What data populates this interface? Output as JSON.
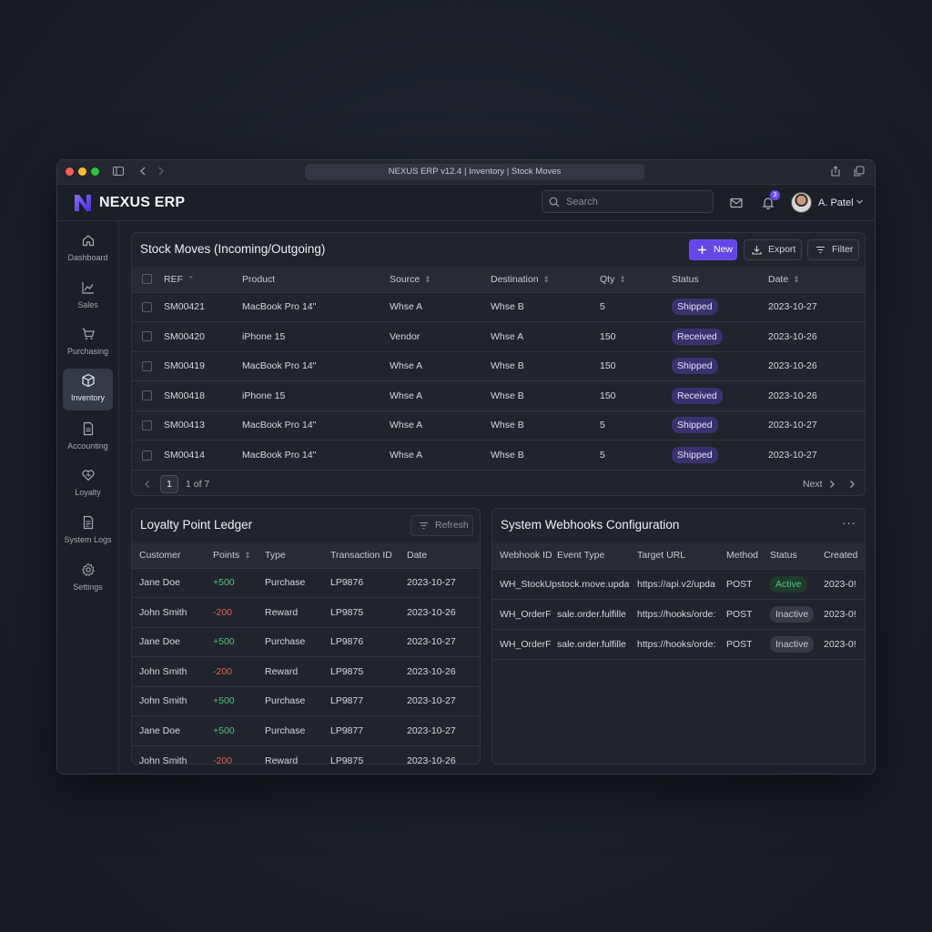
{
  "browser": {
    "url_title": "NEXUS ERP v12.4 | Inventory | Stock Moves"
  },
  "app": {
    "brand": "NEXUS ERP"
  },
  "header": {
    "search_placeholder": "Search",
    "notification_count": "3",
    "user_name": "A. Patel"
  },
  "sidebar": {
    "items": [
      {
        "label": "Dashboard",
        "icon": "home-icon"
      },
      {
        "label": "Sales",
        "icon": "chart-icon"
      },
      {
        "label": "Purchasing",
        "icon": "cart-icon"
      },
      {
        "label": "Inventory",
        "icon": "box-icon",
        "active": true
      },
      {
        "label": "Accounting",
        "icon": "document-icon"
      },
      {
        "label": "Loyalty",
        "icon": "heart-icon"
      },
      {
        "label": "System Logs",
        "icon": "log-icon"
      },
      {
        "label": "Settings",
        "icon": "gear-icon"
      }
    ]
  },
  "stock_moves": {
    "title": "Stock Moves (Incoming/Outgoing)",
    "buttons": {
      "new": "New",
      "export": "Export",
      "filter": "Filter"
    },
    "columns": [
      "REF",
      "Product",
      "Source",
      "Destination",
      "Qty",
      "Status",
      "Date"
    ],
    "rows": [
      {
        "ref": "SM00421",
        "product": "MacBook Pro 14\"",
        "source": "Whse A",
        "destination": "Whse B",
        "qty": "5",
        "status": "Shipped",
        "date": "2023-10-27"
      },
      {
        "ref": "SM00420",
        "product": "iPhone 15",
        "source": "Vendor",
        "destination": "Whse A",
        "qty": "150",
        "status": "Received",
        "date": "2023-10-26"
      },
      {
        "ref": "SM00419",
        "product": "MacBook Pro 14\"",
        "source": "Whse A",
        "destination": "Whse B",
        "qty": "150",
        "status": "Shipped",
        "date": "2023-10-26"
      },
      {
        "ref": "SM00418",
        "product": "iPhone 15",
        "source": "Whse A",
        "destination": "Whse B",
        "qty": "150",
        "status": "Received",
        "date": "2023-10-26"
      },
      {
        "ref": "SM00413",
        "product": "MacBook Pro 14\"",
        "source": "Whse A",
        "destination": "Whse B",
        "qty": "5",
        "status": "Shipped",
        "date": "2023-10-27"
      },
      {
        "ref": "SM00414",
        "product": "MacBook Pro 14\"",
        "source": "Whse A",
        "destination": "Whse B",
        "qty": "5",
        "status": "Shipped",
        "date": "2023-10-27"
      }
    ],
    "pager": {
      "page": "1",
      "of_label": "1 of 7",
      "next_label": "Next"
    }
  },
  "loyalty": {
    "title": "Loyalty Point Ledger",
    "refresh_label": "Refresh",
    "columns": [
      "Customer",
      "Points",
      "Type",
      "Transaction ID",
      "Date"
    ],
    "rows": [
      {
        "customer": "Jane Doe",
        "points": "+500",
        "type": "Purchase",
        "txn": "LP9876",
        "date": "2023-10-27"
      },
      {
        "customer": "John Smith",
        "points": "-200",
        "type": "Reward",
        "txn": "LP9875",
        "date": "2023-10-26"
      },
      {
        "customer": "Jane Doe",
        "points": "+500",
        "type": "Purchase",
        "txn": "LP9876",
        "date": "2023-10-27"
      },
      {
        "customer": "John Smith",
        "points": "-200",
        "type": "Reward",
        "txn": "LP9875",
        "date": "2023-10-26"
      },
      {
        "customer": "John Smith",
        "points": "+500",
        "type": "Purchase",
        "txn": "LP9877",
        "date": "2023-10-27"
      },
      {
        "customer": "Jane Doe",
        "points": "+500",
        "type": "Purchase",
        "txn": "LP9877",
        "date": "2023-10-27"
      },
      {
        "customer": "John Smith",
        "points": "-200",
        "type": "Reward",
        "txn": "LP9875",
        "date": "2023-10-26"
      }
    ]
  },
  "webhooks": {
    "title": "System Webhooks Configuration",
    "more_label": "···",
    "columns": [
      "Webhook ID",
      "Event Type",
      "Target URL",
      "Method",
      "Status",
      "Created"
    ],
    "rows": [
      {
        "id": "WH_StockUp",
        "event": "stock.move.upda",
        "url": "https://api.v2/upda",
        "method": "POST",
        "status": "Active",
        "created": "2023-0!"
      },
      {
        "id": "WH_OrderF",
        "event": "sale.order.fulfille",
        "url": "https://hooks/orde:",
        "method": "POST",
        "status": "Inactive",
        "created": "2023-0!"
      },
      {
        "id": "WH_OrderF",
        "event": "sale.order.fulfille",
        "url": "https://hooks/orde:",
        "method": "POST",
        "status": "Inactive",
        "created": "2023-0!"
      }
    ]
  },
  "colors": {
    "accent": "#6646e8",
    "positive": "#4fc47a",
    "negative": "#e0605c",
    "shipped_pill": "#3a3270",
    "active_pill": "#203a2b"
  }
}
